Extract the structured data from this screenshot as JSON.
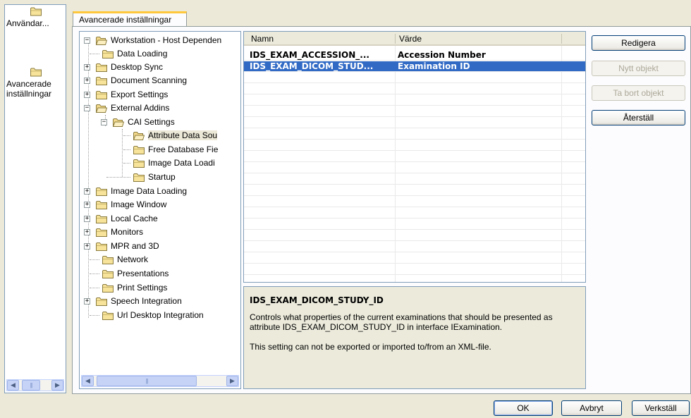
{
  "sidebar": {
    "items": [
      {
        "label": "Användar...",
        "icon": "folder-icon"
      },
      {
        "label": "Avancerade inställningar",
        "icon": "folder-icon"
      }
    ]
  },
  "tab": {
    "label": "Avancerade inställningar"
  },
  "tree": {
    "root": "Workstation - Host Dependen",
    "nodes": [
      "Data Loading",
      "Desktop Sync",
      "Document Scanning",
      "Export Settings",
      "External Addins",
      "CAI Settings",
      "Attribute Data Sou",
      "Free Database Fie",
      "Image Data Loadi",
      "Startup",
      "Image Data Loading",
      "Image Window",
      "Local Cache",
      "Monitors",
      "MPR and 3D",
      "Network",
      "Presentations",
      "Print Settings",
      "Speech Integration",
      "Url Desktop Integration"
    ]
  },
  "grid": {
    "columns": [
      "Namn",
      "Värde"
    ],
    "rows": [
      {
        "name": "IDS_EXAM_ACCESSION_...",
        "value": "Accession Number"
      },
      {
        "name": "IDS_EXAM_DICOM_STUD...",
        "value": "Examination ID"
      }
    ]
  },
  "description": {
    "title": "IDS_EXAM_DICOM_STUDY_ID",
    "text1": "Controls what properties of the current examinations that should be presented as attribute IDS_EXAM_DICOM_STUDY_ID in interface IExamination.",
    "text2": "This setting can not be exported or imported to/from an XML-file."
  },
  "side_buttons": {
    "edit": "Redigera",
    "new_object": "Nytt objekt",
    "remove_object": "Ta bort objekt",
    "reset": "Återställ"
  },
  "footer": {
    "ok": "OK",
    "cancel": "Avbryt",
    "apply": "Verkställ"
  }
}
